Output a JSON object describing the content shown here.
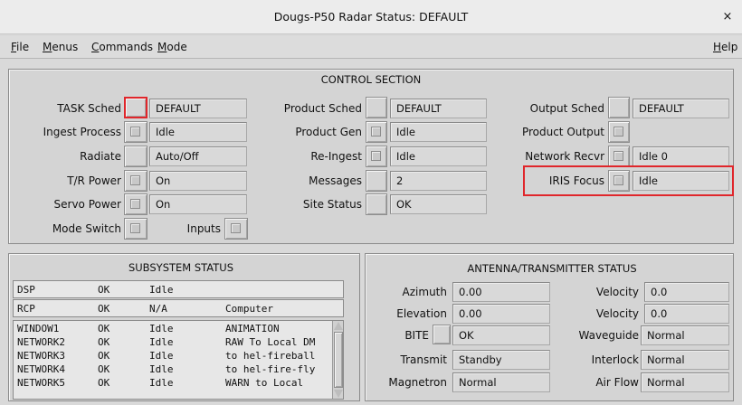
{
  "window": {
    "title": "Dougs-P50  Radar Status: DEFAULT",
    "close_glyph": "×"
  },
  "menubar": {
    "file": "File",
    "menus": "Menus",
    "commands": "Commands",
    "mode": "Mode",
    "help": "Help"
  },
  "control": {
    "title": "CONTROL SECTION",
    "left": {
      "task_sched": {
        "label": "TASK Sched",
        "value": "DEFAULT"
      },
      "ingest_process": {
        "label": "Ingest Process",
        "value": "Idle"
      },
      "radiate": {
        "label": "Radiate",
        "value": "Auto/Off"
      },
      "tr_power": {
        "label": "T/R Power",
        "value": "On"
      },
      "servo_power": {
        "label": "Servo Power",
        "value": "On"
      },
      "mode_switch": {
        "label": "Mode Switch"
      },
      "inputs": {
        "label": "Inputs"
      }
    },
    "middle": {
      "product_sched": {
        "label": "Product Sched",
        "value": "DEFAULT"
      },
      "product_gen": {
        "label": "Product Gen",
        "value": "Idle"
      },
      "re_ingest": {
        "label": "Re-Ingest",
        "value": "Idle"
      },
      "messages": {
        "label": "Messages",
        "value": "2"
      },
      "site_status": {
        "label": "Site Status",
        "value": "OK"
      }
    },
    "right": {
      "output_sched": {
        "label": "Output Sched",
        "value": "DEFAULT"
      },
      "product_output": {
        "label": "Product Output"
      },
      "network_recvr": {
        "label": "Network Recvr",
        "value": "Idle  0"
      },
      "iris_focus": {
        "label": "IRIS Focus",
        "value": "Idle"
      }
    },
    "highlight_color": "#e0262b"
  },
  "subsystem": {
    "title": "SUBSYSTEM STATUS",
    "fixed_rows": [
      {
        "name": "DSP",
        "status": "OK",
        "state": "Idle",
        "info": ""
      },
      {
        "name": "RCP",
        "status": "OK",
        "state": "N/A",
        "info": "Computer"
      }
    ],
    "list_rows": [
      {
        "name": "WINDOW1",
        "status": "OK",
        "state": "Idle",
        "info": "ANIMATION"
      },
      {
        "name": "NETWORK2",
        "status": "OK",
        "state": "Idle",
        "info": "RAW To Local DM"
      },
      {
        "name": "NETWORK3",
        "status": "OK",
        "state": "Idle",
        "info": "to hel-fireball"
      },
      {
        "name": "NETWORK4",
        "status": "OK",
        "state": "Idle",
        "info": "to hel-fire-fly"
      },
      {
        "name": "NETWORK5",
        "status": "OK",
        "state": "Idle",
        "info": "WARN to Local"
      }
    ]
  },
  "antenna": {
    "title": "ANTENNA/TRANSMITTER STATUS",
    "azimuth": {
      "label": "Azimuth",
      "value": "0.00"
    },
    "elevation": {
      "label": "Elevation",
      "value": "0.00"
    },
    "bite": {
      "label": "BITE",
      "value": "OK"
    },
    "transmit": {
      "label": "Transmit",
      "value": "Standby"
    },
    "magnetron": {
      "label": "Magnetron",
      "value": "Normal"
    },
    "velocity1": {
      "label": "Velocity",
      "value": "0.0"
    },
    "velocity2": {
      "label": "Velocity",
      "value": "0.0"
    },
    "waveguide": {
      "label": "Waveguide",
      "value": "Normal"
    },
    "interlock": {
      "label": "Interlock",
      "value": "Normal"
    },
    "air_flow": {
      "label": "Air Flow",
      "value": "Normal"
    }
  }
}
